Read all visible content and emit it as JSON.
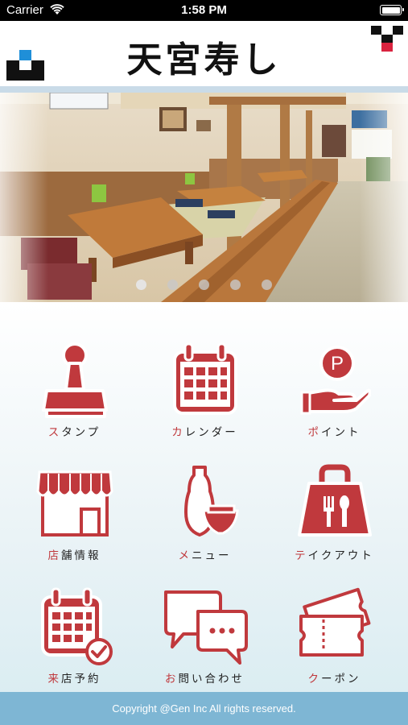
{
  "status_bar": {
    "carrier": "Carrier",
    "time": "1:58 PM"
  },
  "header": {
    "title": "天宮寿し"
  },
  "carousel": {
    "page_count": 5,
    "active_index": 0
  },
  "menu": {
    "items": [
      {
        "label_first": "ス",
        "label_rest": "タンプ",
        "icon": "stamp-icon"
      },
      {
        "label_first": "カ",
        "label_rest": "レンダー",
        "icon": "calendar-icon"
      },
      {
        "label_first": "ポ",
        "label_rest": "イント",
        "icon": "point-coin-icon"
      },
      {
        "label_first": "店",
        "label_rest": "舗情報",
        "icon": "storefront-icon"
      },
      {
        "label_first": "メ",
        "label_rest": "ニュー",
        "icon": "sake-bottle-icon"
      },
      {
        "label_first": "テ",
        "label_rest": "イクアウト",
        "icon": "takeout-bag-icon"
      },
      {
        "label_first": "来",
        "label_rest": "店予約",
        "icon": "reservation-calendar-icon"
      },
      {
        "label_first": "お",
        "label_rest": "問い合わせ",
        "icon": "chat-bubbles-icon"
      },
      {
        "label_first": "ク",
        "label_rest": "ーポン",
        "icon": "coupon-icon"
      }
    ],
    "coin_letter": "P"
  },
  "footer": {
    "copyright": "Copyright @Gen Inc All rights reserved."
  },
  "colors": {
    "accent": "#c0393d",
    "footer_bg": "#7eb6d4",
    "header_strip": "#c9dbe8"
  }
}
